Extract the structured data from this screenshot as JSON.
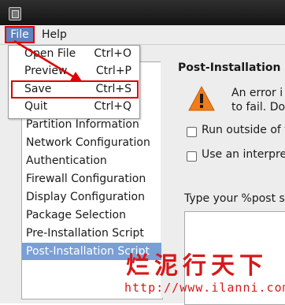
{
  "menubar": {
    "file_label": "File",
    "help_label": "Help"
  },
  "file_menu": {
    "items": [
      {
        "label": "Open File",
        "shortcut": "Ctrl+O"
      },
      {
        "label": "Preview",
        "shortcut": "Ctrl+P"
      },
      {
        "label": "Save",
        "shortcut": "Ctrl+S"
      },
      {
        "label": "Quit",
        "shortcut": "Ctrl+Q"
      }
    ]
  },
  "sidebar": {
    "items": [
      {
        "label": "Partition Information"
      },
      {
        "label": "Network Configuration"
      },
      {
        "label": "Authentication"
      },
      {
        "label": "Firewall Configuration"
      },
      {
        "label": "Display Configuration"
      },
      {
        "label": "Package Selection"
      },
      {
        "label": "Pre-Installation Script"
      },
      {
        "label": "Post-Installation Script"
      }
    ],
    "selected_index": 7
  },
  "main": {
    "title": "Post-Installation S",
    "error_line1": "An error i",
    "error_line2": "to fail. Do",
    "option_outside": "Run outside of t",
    "option_interpreter": "Use an interpret",
    "post_script_label": "Type your %post sc"
  },
  "watermark": {
    "chinese": "烂泥行天下",
    "url": "http://www.ilanni.com"
  },
  "colors": {
    "highlight_red": "#e00000",
    "selection_blue": "#7a9fd6",
    "menu_active": "#5d84c0",
    "warning_orange": "#f07d1a"
  }
}
